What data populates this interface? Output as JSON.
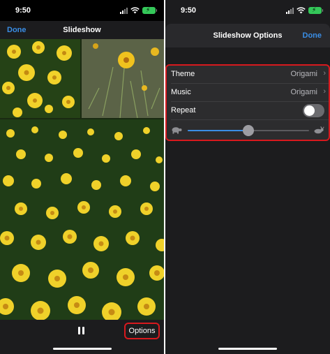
{
  "left": {
    "status_time": "9:50",
    "nav": {
      "done_label": "Done",
      "title": "Slideshow"
    },
    "bottom": {
      "options_label": "Options"
    }
  },
  "right": {
    "status_time": "9:50",
    "sheet": {
      "title": "Slideshow Options",
      "done_label": "Done",
      "rows": [
        {
          "label": "Theme",
          "value": "Origami"
        },
        {
          "label": "Music",
          "value": "Origami"
        },
        {
          "label": "Repeat",
          "toggle_on": false
        }
      ],
      "speed": {
        "level": 0.5
      }
    }
  },
  "colors": {
    "accent": "#3a8ee6",
    "highlight": "#d8191e",
    "battery": "#34c759"
  },
  "icons": [
    "signal-icon",
    "wifi-icon",
    "battery-icon",
    "pause-icon",
    "chevron-right-icon",
    "turtle-icon",
    "hare-icon"
  ]
}
